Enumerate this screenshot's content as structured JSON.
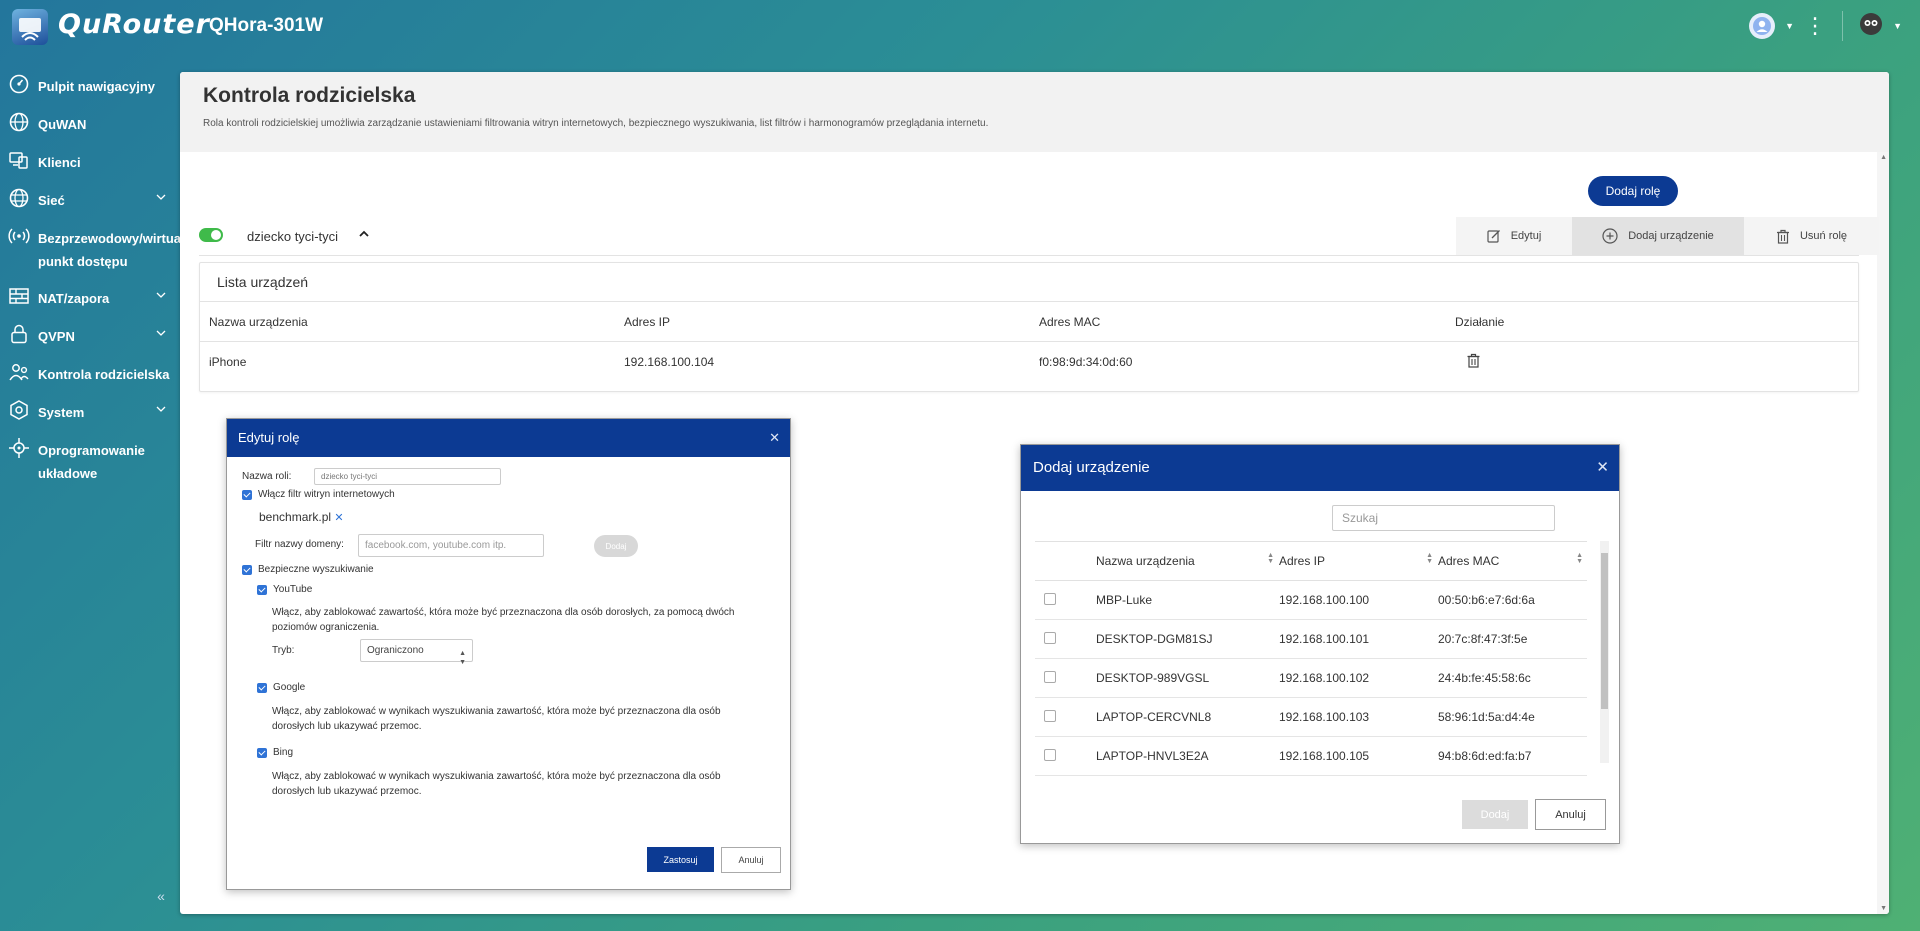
{
  "app": {
    "logo_text": "QuRouter",
    "device_name": "QHora-301W"
  },
  "sidebar": {
    "items": [
      {
        "label": "Pulpit nawigacyjny",
        "icon": "dashboard-icon"
      },
      {
        "label": "QuWAN",
        "icon": "globe-network-icon"
      },
      {
        "label": "Klienci",
        "icon": "clients-icon"
      },
      {
        "label": "Sieć",
        "icon": "globe-icon"
      },
      {
        "label": "Bezprzewodowy/wirtualny punkt dostępu",
        "label_l1": "Bezprzewodowy/wirtualny",
        "label_l2": "punkt dostępu",
        "icon": "wifi-icon"
      },
      {
        "label": "NAT/zapora",
        "icon": "firewall-icon"
      },
      {
        "label": "QVPN",
        "icon": "lock-icon"
      },
      {
        "label": "Kontrola rodzicielska",
        "icon": "parental-control-icon"
      },
      {
        "label": "System",
        "icon": "gear-icon"
      },
      {
        "label": "Oprogramowanie układowe",
        "label_l1": "Oprogramowanie",
        "label_l2": "układowe",
        "icon": "firmware-icon"
      }
    ]
  },
  "page": {
    "title": "Kontrola rodzicielska",
    "description": "Rola kontroli rodzicielskiej umożliwia zarządzanie ustawieniami filtrowania witryn internetowych, bezpiecznego wyszukiwania, list filtrów i harmonogramów przeglądania internetu.",
    "add_role_label": "Dodaj rolę"
  },
  "role": {
    "name": "dziecko tyci-tyci",
    "enabled": true,
    "actions": {
      "edit": "Edytuj",
      "add_device": "Dodaj urządzenie",
      "delete_role": "Usuń rolę"
    }
  },
  "device_list": {
    "title": "Lista urządzeń",
    "columns": [
      "Nazwa urządzenia",
      "Adres IP",
      "Adres MAC",
      "Działanie"
    ],
    "rows": [
      {
        "name": "iPhone",
        "ip": "192.168.100.104",
        "mac": "f0:98:9d:34:0d:60"
      }
    ]
  },
  "edit_modal": {
    "title": "Edytuj rolę",
    "role_name_label": "Nazwa roli:",
    "role_name_value": "dziecko tyci-tyci",
    "web_filter_label": "Włącz filtr witryn internetowych",
    "domain_tag": "benchmark.pl",
    "domain_filter_label": "Filtr nazwy domeny:",
    "domain_filter_placeholder": "facebook.com, youtube.com itp.",
    "add_label": "Dodaj",
    "safe_search_label": "Bezpieczne wyszukiwanie",
    "youtube": {
      "label": "YouTube",
      "desc_l1": "Włącz, aby zablokować zawartość, która może być przeznaczona dla osób dorosłych, za pomocą dwóch",
      "desc_l2": "poziomów ograniczenia."
    },
    "mode_label": "Tryb:",
    "mode_value": "Ograniczono",
    "google": {
      "label": "Google",
      "desc_l1": "Włącz, aby zablokować w wynikach wyszukiwania zawartość, która może być przeznaczona dla osób",
      "desc_l2": "dorosłych lub ukazywać przemoc."
    },
    "bing": {
      "label": "Bing",
      "desc_l1": "Włącz, aby zablokować w wynikach wyszukiwania zawartość, która może być przeznaczona dla osób",
      "desc_l2": "dorosłych lub ukazywać przemoc."
    },
    "apply_label": "Zastosuj",
    "cancel_label": "Anuluj"
  },
  "add_modal": {
    "title": "Dodaj urządzenie",
    "search_placeholder": "Szukaj",
    "columns": [
      "Nazwa urządzenia",
      "Adres IP",
      "Adres MAC"
    ],
    "rows": [
      {
        "name": "MBP-Luke",
        "ip": "192.168.100.100",
        "mac": "00:50:b6:e7:6d:6a"
      },
      {
        "name": "DESKTOP-DGM81SJ",
        "ip": "192.168.100.101",
        "mac": "20:7c:8f:47:3f:5e"
      },
      {
        "name": "DESKTOP-989VGSL",
        "ip": "192.168.100.102",
        "mac": "24:4b:fe:45:58:6c"
      },
      {
        "name": "LAPTOP-CERCVNL8",
        "ip": "192.168.100.103",
        "mac": "58:96:1d:5a:d4:4e"
      },
      {
        "name": "LAPTOP-HNVL3E2A",
        "ip": "192.168.100.105",
        "mac": "94:b8:6d:ed:fa:b7"
      }
    ],
    "add_label": "Dodaj",
    "cancel_label": "Anuluj"
  },
  "colors": {
    "brand": "#0c3a93",
    "toggle_on": "#3fba4a",
    "checkbox": "#2f73d6"
  }
}
